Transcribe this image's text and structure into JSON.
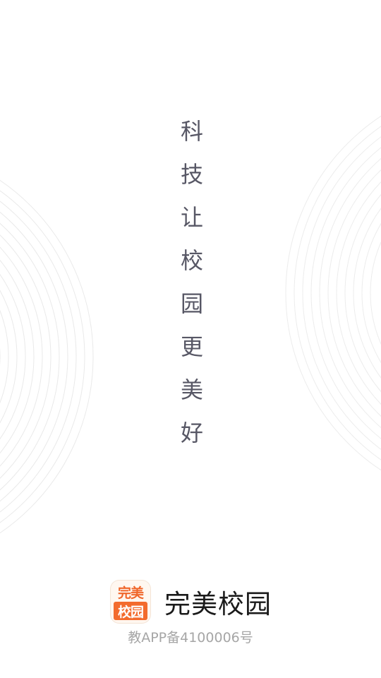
{
  "slogan": {
    "chars": [
      "科",
      "技",
      "让",
      "校",
      "园",
      "更",
      "美",
      "好"
    ]
  },
  "brand": {
    "icon_top_text": "完美",
    "icon_bottom_text": "校园",
    "app_name": "完美校园"
  },
  "footer": {
    "license": "教APP备4100006号"
  },
  "colors": {
    "accent": "#f36b2d",
    "slogan": "#575765",
    "license": "#a6a6a6"
  }
}
